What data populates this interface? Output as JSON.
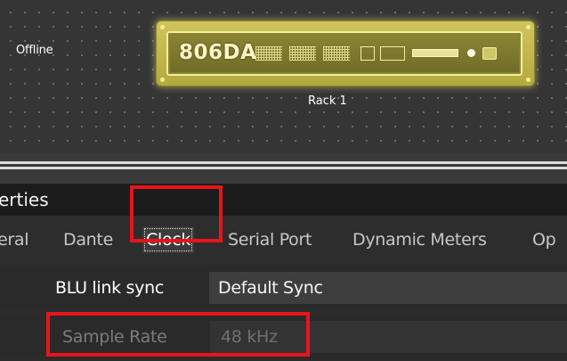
{
  "canvas": {
    "status_label": "Offline",
    "device": {
      "name": "806DA"
    },
    "rack_label": "Rack 1"
  },
  "properties": {
    "title": "erties",
    "tabs": [
      {
        "label": "eral",
        "active": false
      },
      {
        "label": "Dante",
        "active": false
      },
      {
        "label": "Clock",
        "active": true
      },
      {
        "label": "Serial Port",
        "active": false
      },
      {
        "label": "Dynamic Meters",
        "active": false
      },
      {
        "label": "Op",
        "active": false
      }
    ],
    "rows": [
      {
        "label": "BLU link sync",
        "value": "Default Sync",
        "enabled": true
      },
      {
        "label": "Sample Rate",
        "value": "48 kHz",
        "enabled": false
      }
    ]
  },
  "colors": {
    "highlight": "#e8141b",
    "device_accent": "#cfc55c"
  }
}
